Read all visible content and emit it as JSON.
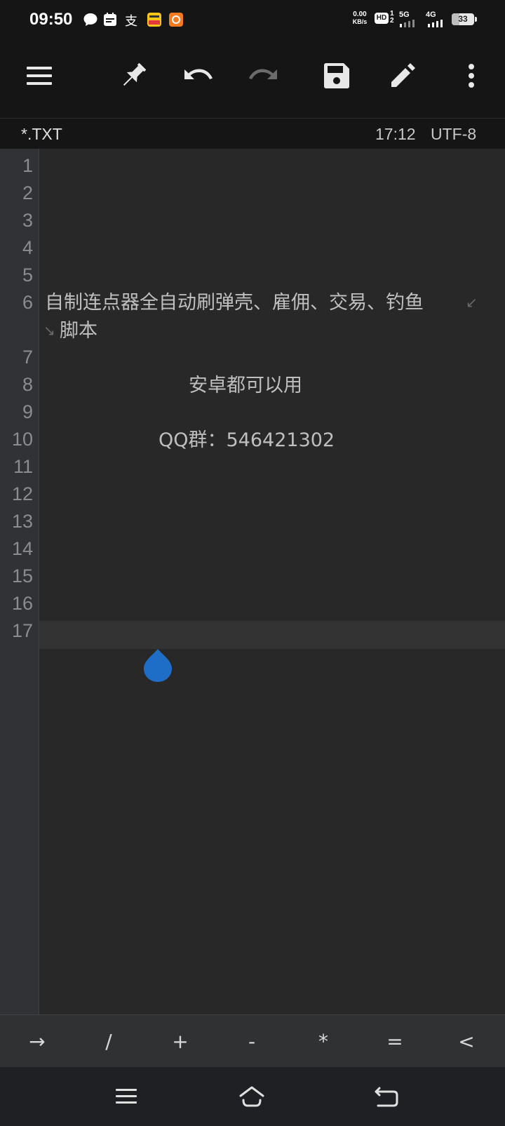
{
  "status_bar": {
    "time": "09:50",
    "net_speed_value": "0.00",
    "net_speed_unit": "KB/s",
    "hd_label": "HD",
    "hd_sub_top": "1",
    "hd_sub_bottom": "2",
    "sim1_label": "5G",
    "sim2_label": "4G",
    "battery_level": "33",
    "battery_fraction": 0.33,
    "notification_icons": [
      "chat-bubble-icon",
      "calendar-icon",
      "alipay-icon",
      "meituan-icon",
      "app-icon"
    ]
  },
  "toolbar": {
    "icons": [
      "menu-icon",
      "pin-icon",
      "undo-icon",
      "redo-icon",
      "save-icon",
      "edit-icon",
      "more-icon"
    ]
  },
  "info_bar": {
    "filename": "*.TXT",
    "cursor_position": "17:12",
    "encoding": "UTF-8"
  },
  "editor": {
    "line_numbers": [
      "1",
      "2",
      "3",
      "4",
      "5",
      "6",
      "7",
      "8",
      "9",
      "10",
      "11",
      "12",
      "13",
      "14",
      "15",
      "16",
      "17"
    ],
    "line6_part1": "自制连点器全自动刷弹壳、雇佣、交易、钓鱼",
    "line6_part2": "脚本",
    "line8": "安卓都可以用",
    "line10": "QQ群：546421302",
    "wrap_mark_end": "↙",
    "wrap_mark_start": "↘"
  },
  "symbol_bar": {
    "keys": [
      "→",
      "/",
      "+",
      "-",
      "*",
      "=",
      "<"
    ]
  },
  "nav_bar": {
    "icons": [
      "recent-apps-icon",
      "home-icon",
      "back-icon"
    ]
  },
  "colors": {
    "background": "#151515",
    "editor_bg": "#282828",
    "gutter_bg": "#313235",
    "caret_handle": "#1e6ec8"
  }
}
